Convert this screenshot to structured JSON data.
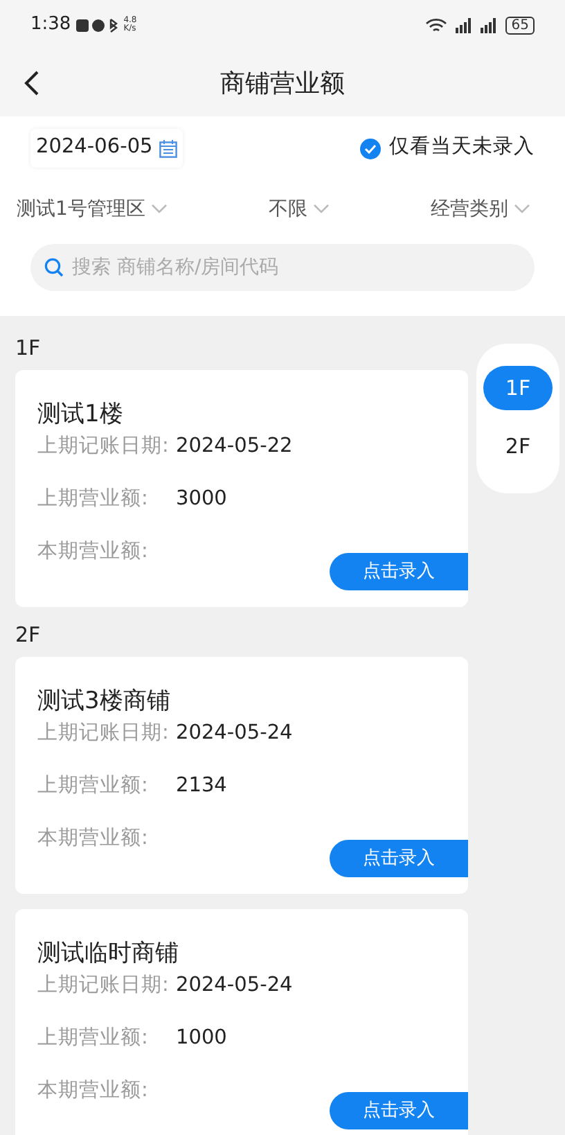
{
  "status_bar": {
    "time": "1:38",
    "speed_value": "4.8",
    "speed_unit": "K/s",
    "battery": "65"
  },
  "header": {
    "title": "商铺营业额"
  },
  "filters": {
    "date": "2024-06-05",
    "only_unentered": {
      "label": "仅看当天未录入",
      "checked": true
    },
    "dropdowns": [
      "测试1号管理区",
      "不限",
      "经营类别"
    ],
    "search": {
      "placeholder": "搜索 商铺名称/房间代码"
    }
  },
  "floors": [
    {
      "label": "1F",
      "shops": [
        {
          "name": "测试1楼",
          "rows": [
            {
              "label": "上期记账日期:",
              "value": "2024-05-22"
            },
            {
              "label": "上期营业额:",
              "value": "3000"
            },
            {
              "label": "本期营业额:"
            }
          ],
          "button": "点击录入"
        }
      ]
    },
    {
      "label": "2F",
      "shops": [
        {
          "name": "测试3楼商铺",
          "rows": [
            {
              "label": "上期记账日期:",
              "value": "2024-05-24"
            },
            {
              "label": "上期营业额:",
              "value": "2134"
            },
            {
              "label": "本期营业额:"
            }
          ],
          "button": "点击录入"
        },
        {
          "name": "测试临时商铺",
          "rows": [
            {
              "label": "上期记账日期:",
              "value": "2024-05-24"
            },
            {
              "label": "上期营业额:",
              "value": "1000"
            },
            {
              "label": "本期营业额:"
            }
          ],
          "button": "点击录入"
        }
      ]
    }
  ],
  "floor_index": [
    {
      "label": "1F",
      "selected": true
    },
    {
      "label": "2F",
      "selected": false
    }
  ]
}
